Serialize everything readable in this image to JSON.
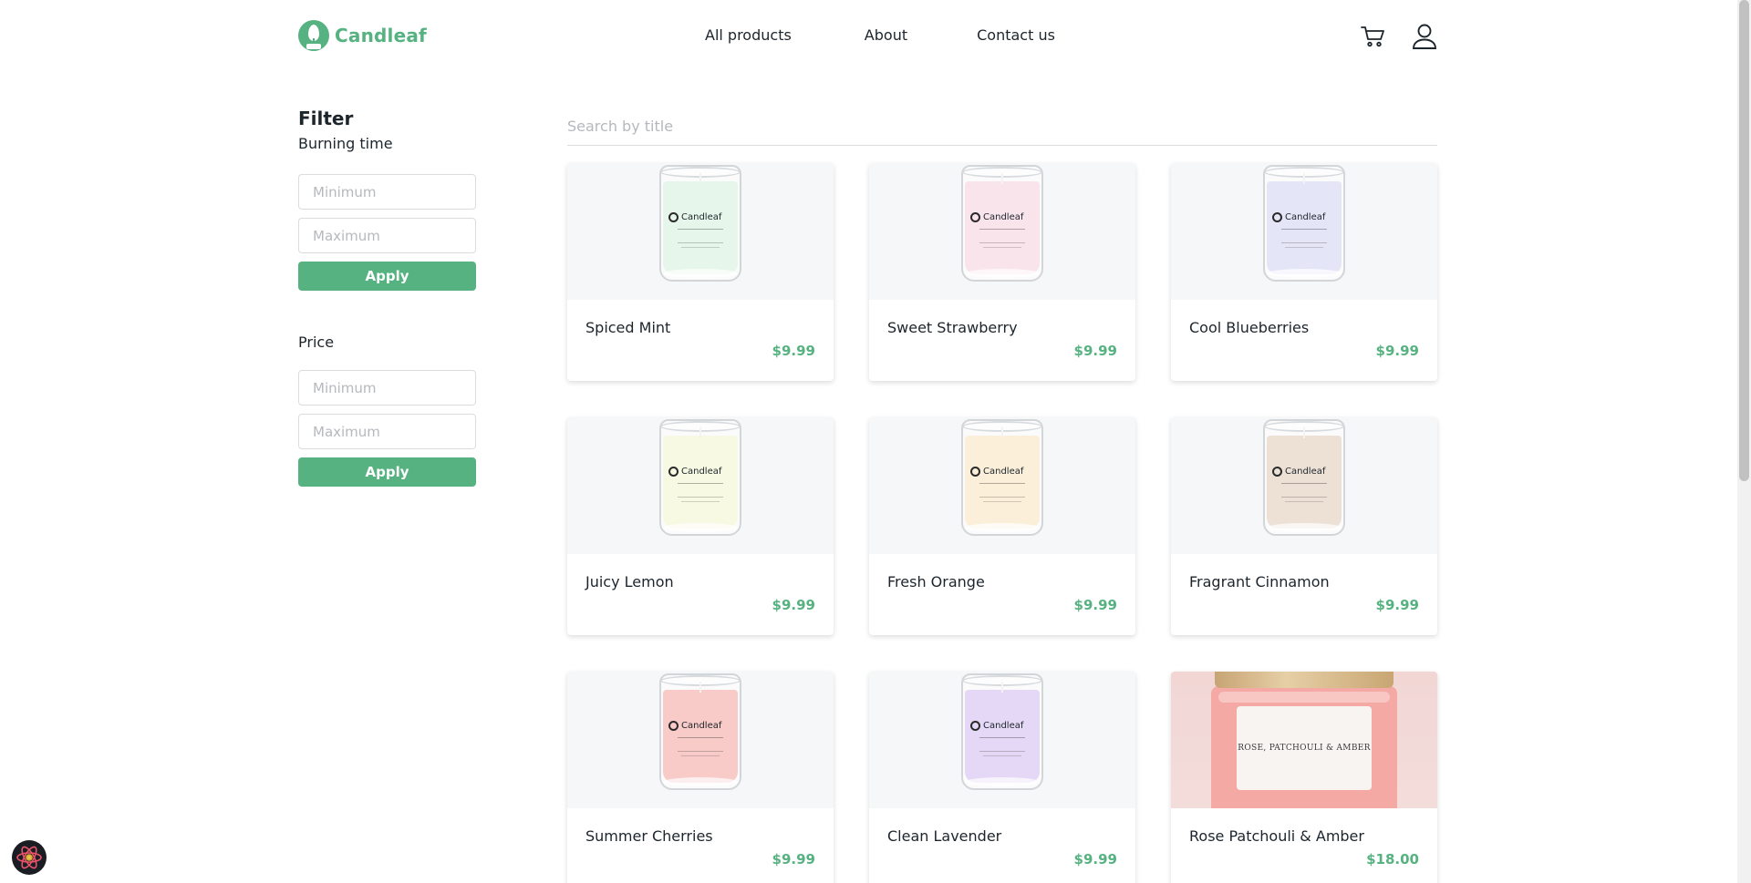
{
  "brand": {
    "name": "Candleaf",
    "color": "#56b280"
  },
  "nav": {
    "items": [
      {
        "label": "All products"
      },
      {
        "label": "About"
      },
      {
        "label": "Contact us"
      }
    ],
    "icons": [
      "cart-icon",
      "user-icon"
    ]
  },
  "filter": {
    "title": "Filter",
    "burning_time": {
      "label": "Burning time",
      "min_placeholder": "Minimum",
      "max_placeholder": "Maximum",
      "apply_label": "Apply"
    },
    "price": {
      "label": "Price",
      "min_placeholder": "Minimum",
      "max_placeholder": "Maximum",
      "apply_label": "Apply"
    }
  },
  "search": {
    "placeholder": "Search by title",
    "value": ""
  },
  "jar_brand": "Candleaf",
  "products": [
    {
      "name": "Spiced Mint",
      "price": "$9.99",
      "wax_color": "#c9ebd3"
    },
    {
      "name": "Sweet Strawberry",
      "price": "$9.99",
      "wax_color": "#f2c4d4"
    },
    {
      "name": "Cool Blueberries",
      "price": "$9.99",
      "wax_color": "#c6c6f0"
    },
    {
      "name": "Juicy Lemon",
      "price": "$9.99",
      "wax_color": "#eef1bf"
    },
    {
      "name": "Fresh Orange",
      "price": "$9.99",
      "wax_color": "#f7dcae"
    },
    {
      "name": "Fragrant Cinnamon",
      "price": "$9.99",
      "wax_color": "#d7bca5"
    },
    {
      "name": "Summer Cherries",
      "price": "$9.99",
      "wax_color": "#f08a86"
    },
    {
      "name": "Clean Lavender",
      "price": "$9.99",
      "wax_color": "#c6a9ec"
    },
    {
      "name": "Rose Patchouli & Amber",
      "price": "$18.00",
      "wax_color": "#f4a9a4",
      "label_text": "ROSE, PATCHOULI & AMBER"
    }
  ],
  "colors": {
    "accent": "#56b280",
    "text": "#1d252c",
    "card_bg": "#f6f7f8"
  }
}
